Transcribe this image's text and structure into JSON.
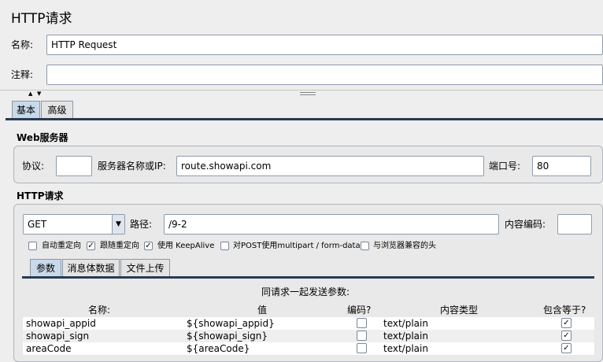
{
  "title": "HTTP请求",
  "name": {
    "label": "名称:",
    "value": "HTTP Request"
  },
  "comment": {
    "label": "注释:",
    "value": ""
  },
  "tabs": [
    "基本",
    "高级"
  ],
  "web_server": {
    "title": "Web服务器",
    "protocol_label": "协议:",
    "protocol_value": "",
    "server_label": "服务器名称或IP:",
    "server_value": "route.showapi.com",
    "port_label": "端口号:",
    "port_value": "80"
  },
  "http_request": {
    "title": "HTTP请求",
    "method": "GET",
    "path_label": "路径:",
    "path_value": "/9-2",
    "encoding_label": "内容编码:",
    "encoding_value": "",
    "options": [
      {
        "label": "自动重定向",
        "checked": false
      },
      {
        "label": "跟随重定向",
        "checked": true
      },
      {
        "label": "使用 KeepAlive",
        "checked": true
      },
      {
        "label": "对POST使用multipart / form-data",
        "checked": false
      },
      {
        "label": "与浏览器兼容的头",
        "checked": false
      }
    ],
    "subtabs": [
      "参数",
      "消息体数据",
      "文件上传"
    ]
  },
  "params": {
    "heading": "同请求一起发送参数:",
    "columns": [
      "名称:",
      "值",
      "编码?",
      "内容类型",
      "包含等于?"
    ],
    "rows": [
      {
        "name": "showapi_appid",
        "value": "${showapi_appid}",
        "encode": false,
        "content_type": "text/plain",
        "include_equals": true
      },
      {
        "name": "showapi_sign",
        "value": "${showapi_sign}",
        "encode": false,
        "content_type": "text/plain",
        "include_equals": true
      },
      {
        "name": "areaCode",
        "value": "${areaCode}",
        "encode": false,
        "content_type": "text/plain",
        "include_equals": true
      }
    ]
  },
  "colors": {
    "selected_tab": "#c8d9ea",
    "divider": "#2b3a52"
  }
}
